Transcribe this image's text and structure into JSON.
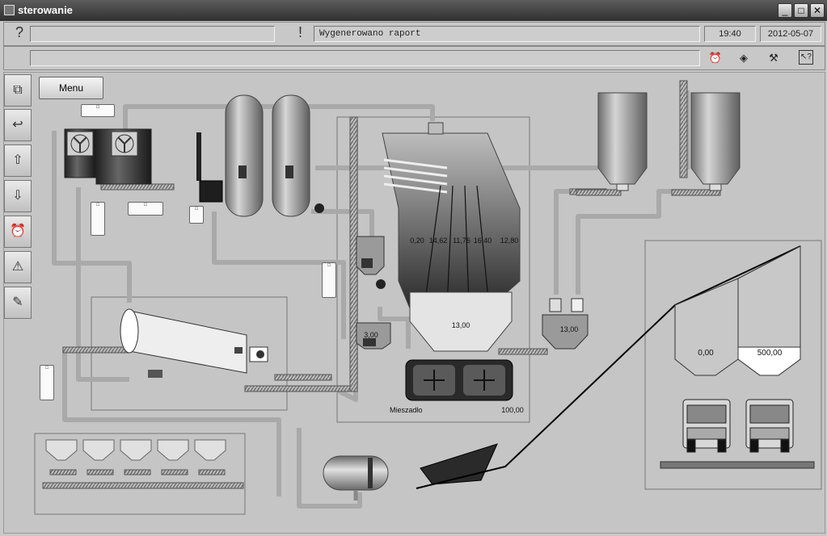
{
  "window": {
    "title": "sterowanie",
    "minimize": "_",
    "maximize": "□",
    "close": "✕"
  },
  "status": {
    "help_glyph": "?",
    "alert_glyph": "!",
    "message": "Wygenerowano raport",
    "time": "19:40",
    "date": "2012-05-07"
  },
  "toolbar": {
    "icons": [
      "alarm-clock-icon",
      "warning-diamond-icon",
      "tools-icon",
      "help-cursor-icon"
    ]
  },
  "sidebar": {
    "buttons": [
      {
        "name": "windows-icon",
        "glyph": "⧉"
      },
      {
        "name": "back-icon",
        "glyph": "↩"
      },
      {
        "name": "up-arrow-icon",
        "glyph": "⇧"
      },
      {
        "name": "down-arrow-icon",
        "glyph": "⇩"
      },
      {
        "name": "alarm-clock-icon",
        "glyph": "⏰"
      },
      {
        "name": "warning-icon",
        "glyph": "⚠"
      },
      {
        "name": "report-icon",
        "glyph": "✎"
      }
    ]
  },
  "menu": {
    "label": "Menu"
  },
  "process": {
    "silo_values": [
      "0,20",
      "14,62",
      "11,76",
      "16,40",
      "12,80"
    ],
    "hopper_value": "13,00",
    "weigh_left": "3,00",
    "weigh_right": "13,00",
    "mixer_label": "Mieszadło",
    "mixer_value": "100,00",
    "bin_left": "0,00",
    "bin_right": "500,00",
    "colors": {
      "pipe": "#a9a9a9",
      "steel": "#9a9a9a",
      "dark": "#2e2e2e"
    }
  }
}
